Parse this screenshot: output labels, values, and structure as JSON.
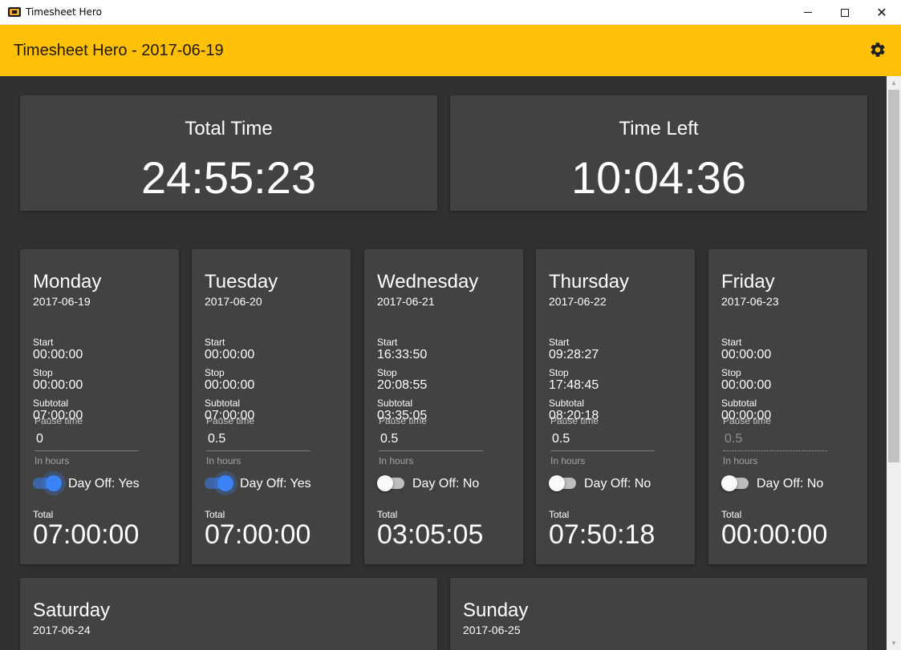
{
  "window": {
    "title": "Timesheet Hero",
    "minimize_icon": "minimize-icon",
    "maximize_icon": "maximize-icon",
    "close_icon": "close-icon",
    "close_glyph": "✕"
  },
  "appbar": {
    "title": "Timesheet Hero - 2017-06-19",
    "settings_icon": "gear-icon",
    "color": "#ffc107"
  },
  "summary": {
    "total_time": {
      "label": "Total Time",
      "value": "24:55:23"
    },
    "time_left": {
      "label": "Time Left",
      "value": "10:04:36"
    }
  },
  "labels": {
    "start": "Start",
    "stop": "Stop",
    "subtotal": "Subtotal",
    "pause_time": "Pause time",
    "in_hours": "In hours",
    "total": "Total"
  },
  "days": [
    {
      "name": "Monday",
      "date": "2017-06-19",
      "start": "00:00:00",
      "stop": "00:00:00",
      "subtotal": "07:00:00",
      "pause": "0",
      "day_off": true,
      "day_off_label": "Day Off: Yes",
      "total": "07:00:00"
    },
    {
      "name": "Tuesday",
      "date": "2017-06-20",
      "start": "00:00:00",
      "stop": "00:00:00",
      "subtotal": "07:00:00",
      "pause": "0.5",
      "day_off": true,
      "day_off_label": "Day Off: Yes",
      "total": "07:00:00"
    },
    {
      "name": "Wednesday",
      "date": "2017-06-21",
      "start": "16:33:50",
      "stop": "20:08:55",
      "subtotal": "03:35:05",
      "pause": "0.5",
      "day_off": false,
      "day_off_label": "Day Off: No",
      "total": "03:05:05"
    },
    {
      "name": "Thursday",
      "date": "2017-06-22",
      "start": "09:28:27",
      "stop": "17:48:45",
      "subtotal": "08:20:18",
      "pause": "0.5",
      "day_off": false,
      "day_off_label": "Day Off: No",
      "total": "07:50:18"
    },
    {
      "name": "Friday",
      "date": "2017-06-23",
      "start": "00:00:00",
      "stop": "00:00:00",
      "subtotal": "00:00:00",
      "pause": "0.5",
      "pause_disabled": true,
      "day_off": false,
      "day_off_label": "Day Off: No",
      "total": "00:00:00"
    }
  ],
  "weekend": [
    {
      "name": "Saturday",
      "date": "2017-06-24"
    },
    {
      "name": "Sunday",
      "date": "2017-06-25"
    }
  ],
  "colors": {
    "background": "#303030",
    "card": "#424242",
    "accent": "#ffc107",
    "toggle_on": "#3b82f6"
  }
}
